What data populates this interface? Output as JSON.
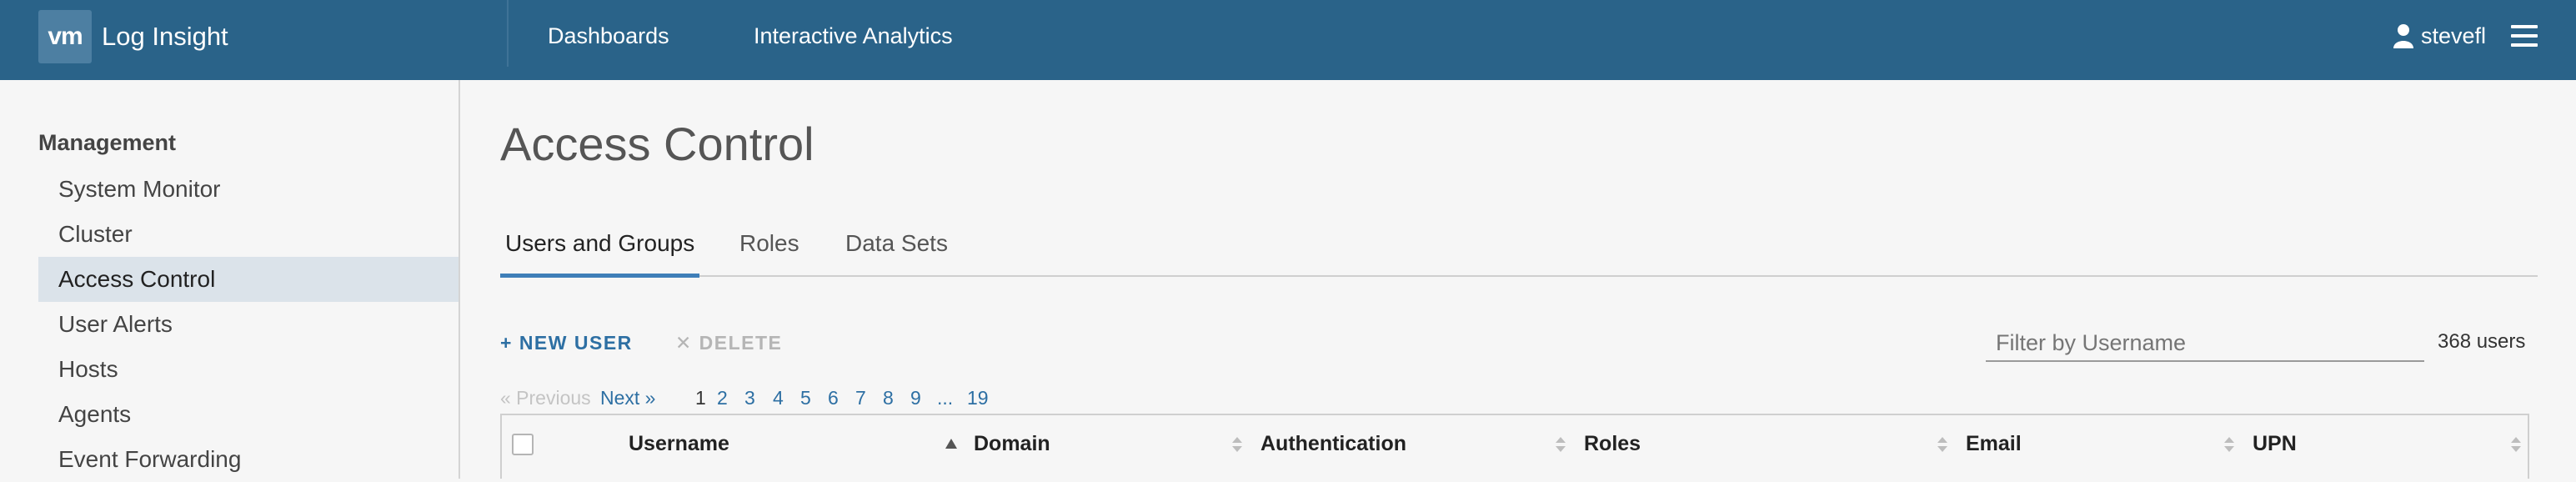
{
  "header": {
    "logo_text": "vm",
    "app_title": "Log Insight",
    "nav": [
      "Dashboards",
      "Interactive Analytics"
    ],
    "username": "stevefl"
  },
  "sidebar": {
    "heading": "Management",
    "items": [
      "System Monitor",
      "Cluster",
      "Access Control",
      "User Alerts",
      "Hosts",
      "Agents",
      "Event Forwarding"
    ],
    "active": "Access Control"
  },
  "main": {
    "title": "Access Control",
    "tabs": [
      "Users and Groups",
      "Roles",
      "Data Sets"
    ],
    "active_tab": "Users and Groups",
    "new_user_label": "+ NEW USER",
    "delete_label": "✕ DELETE",
    "filter_placeholder": "Filter by Username",
    "user_count": "368 users",
    "pagination": {
      "previous": "« Previous",
      "next": "Next »",
      "pages": [
        "1",
        "2",
        "3",
        "4",
        "5",
        "6",
        "7",
        "8",
        "9",
        "...",
        "19"
      ],
      "current": "1"
    },
    "table": {
      "columns": [
        "Username",
        "Domain",
        "Authentication",
        "Roles",
        "Email",
        "UPN"
      ]
    }
  },
  "colors": {
    "header_bg": "#2a6389",
    "accent": "#2d6fa3",
    "active_sidebar": "#dbe3ea"
  }
}
